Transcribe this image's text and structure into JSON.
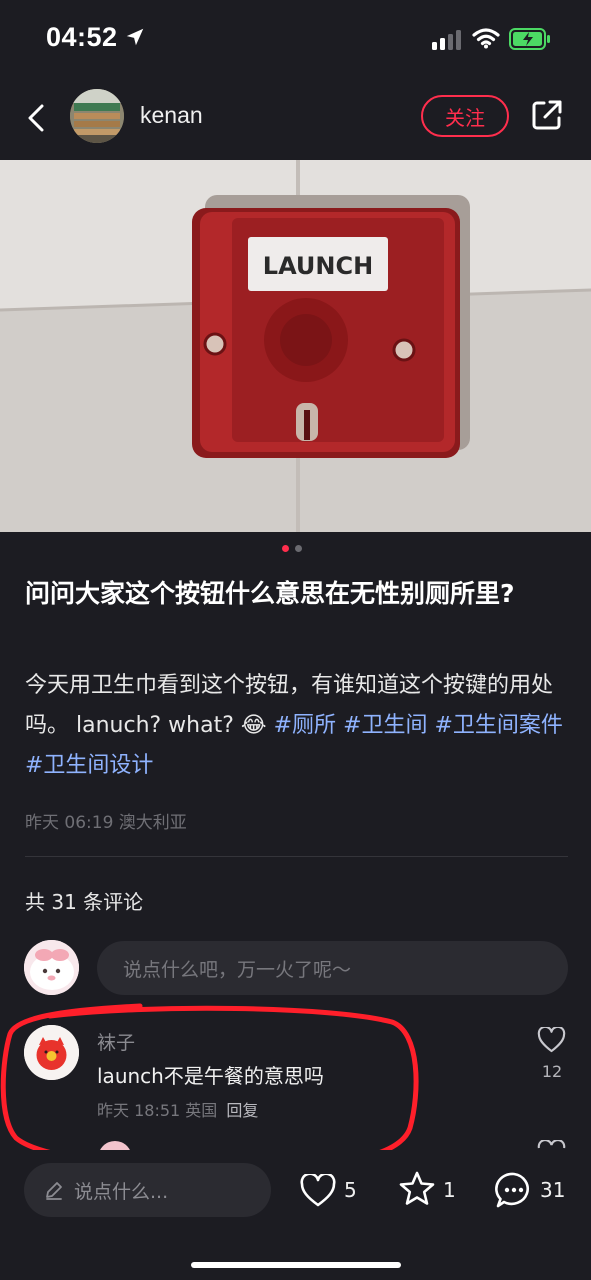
{
  "status_bar": {
    "time": "04:52"
  },
  "header": {
    "username": "kenan",
    "follow_label": "关注"
  },
  "photo": {
    "label_text": "LAUNCH",
    "slide_count": 2,
    "active_slide": 1
  },
  "post": {
    "title": "问问大家这个按钮什么意思在无性别厕所里?",
    "body_text": "今天用卫生巾看到这个按钮，有谁知道这个按键的用处吗。 lanuch? what? ",
    "emoji": "😂",
    "hashtags": [
      "#厕所",
      "#卫生间",
      "#卫生间案件",
      "#卫生间设计"
    ],
    "meta": "昨天 06:19 澳大利亚"
  },
  "comments_section": {
    "count_label": "共 31 条评论",
    "input_placeholder": "说点什么吧，万一火了呢～"
  },
  "comment": {
    "author": "袜子",
    "text": "launch不是午餐的意思吗",
    "meta": "昨天 18:51 英国",
    "reply_label": "回复",
    "like_count": "12"
  },
  "bottom_bar": {
    "input_placeholder": "说点什么...",
    "like_count": "5",
    "star_count": "1",
    "comment_count": "31"
  },
  "colors": {
    "background": "#1c1c22",
    "accent_red": "#ff2e4d",
    "hashtag_blue": "#8fb3ff",
    "battery_green": "#4cd964"
  },
  "icons": [
    "back-chevron-icon",
    "share-icon",
    "heart-icon",
    "star-icon",
    "comment-bubble-icon",
    "pencil-icon",
    "location-arrow-icon",
    "wifi-icon",
    "signal-icon",
    "battery-icon"
  ]
}
